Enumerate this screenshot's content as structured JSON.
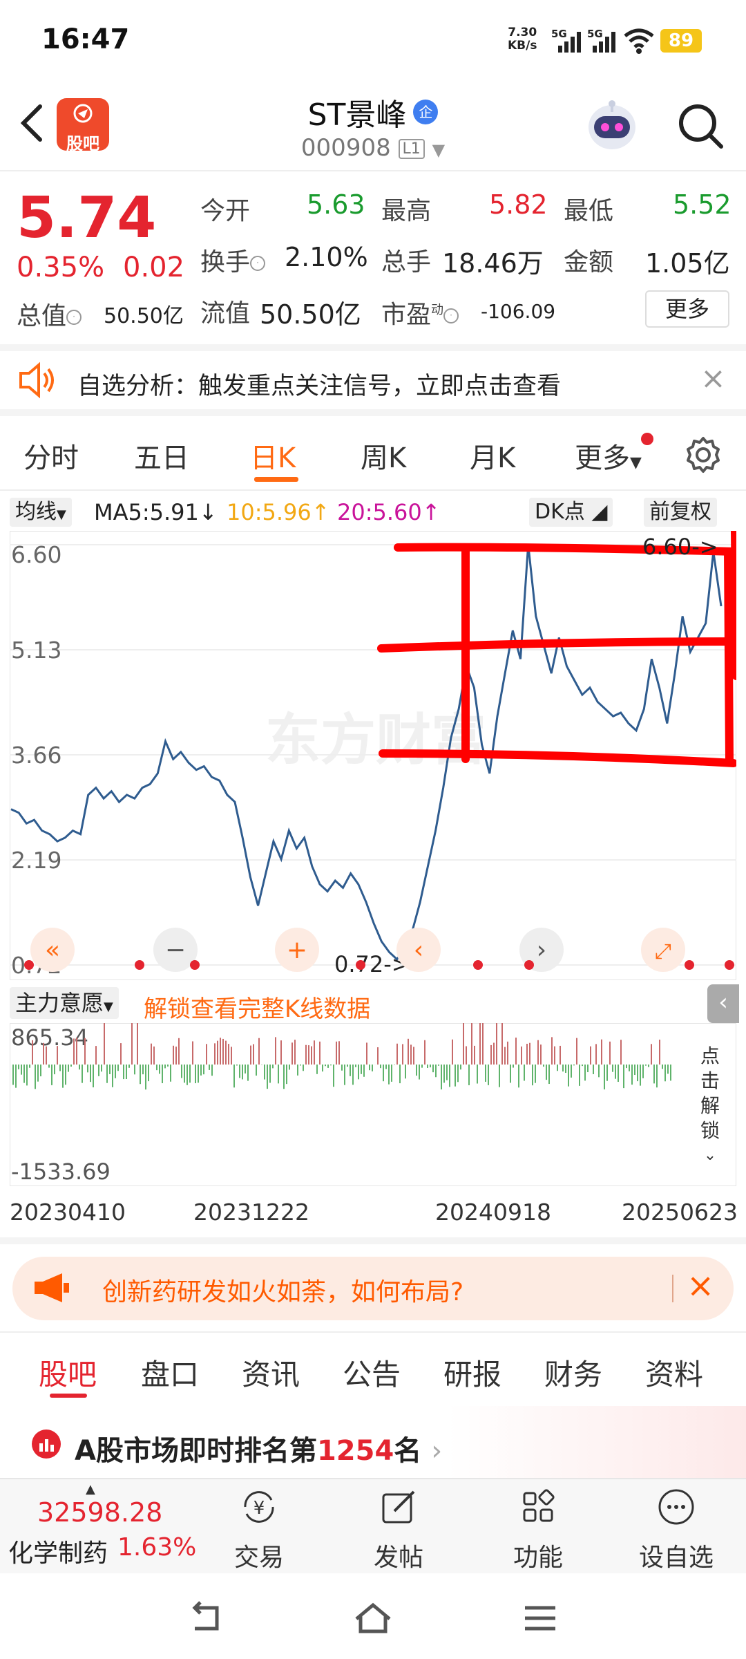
{
  "status_bar": {
    "time": "16:47",
    "net_speed_value": "7.30",
    "net_speed_unit": "KB/s",
    "signal_1": "5G",
    "signal_2": "5G",
    "battery": "89"
  },
  "header": {
    "logo_text": "股吧",
    "stock_name": "ST景峰",
    "qi_badge": "企",
    "stock_code": "000908",
    "level_badge": "L1"
  },
  "quote": {
    "price": "5.74",
    "change_pct": "0.35%",
    "change_abs": "0.02",
    "open_label": "今开",
    "open": "5.63",
    "high_label": "最高",
    "high": "5.82",
    "low_label": "最低",
    "low": "5.52",
    "turnover_label": "换手",
    "turnover": "2.10%",
    "volume_label": "总手",
    "volume": "18.46万",
    "amount_label": "金额",
    "amount": "1.05亿",
    "total_cap_label": "总值",
    "total_cap": "50.50亿",
    "float_cap_label": "流值",
    "float_cap": "50.50亿",
    "pe_label": "市盈",
    "pe_sup": "动",
    "pe": "-106.09",
    "more_label": "更多"
  },
  "banner": {
    "text": "自选分析：触发重点关注信号，立即点击查看"
  },
  "chart_tabs": [
    "分时",
    "五日",
    "日K",
    "周K",
    "月K",
    "更多"
  ],
  "ma_row": {
    "selector": "均线",
    "ma5": "MA5:5.91↓",
    "ma10": "10:5.96↑",
    "ma20": "20:5.60↑",
    "dk": "DK点",
    "fuquan": "前复权"
  },
  "main_chart": {
    "axis_labels": [
      "6.60",
      "5.13",
      "3.66",
      "2.19",
      "0.72"
    ],
    "max_marker": "6.60->",
    "min_marker": "0.72->",
    "watermark": "东方财富"
  },
  "volume_chart": {
    "selector": "主力意愿",
    "unlock_text": "解锁查看完整K线数据",
    "max_label": "865.34",
    "min_label": "-1533.69",
    "side_unlock": [
      "点",
      "击",
      "解",
      "锁"
    ]
  },
  "date_labels": [
    "20230410",
    "20231222",
    "20240918",
    "20250623"
  ],
  "promo": {
    "text": "创新药研发如火如荼，如何布局?"
  },
  "bottom_tabs": [
    "股吧",
    "盘口",
    "资讯",
    "公告",
    "研报",
    "财务",
    "资料"
  ],
  "rank": {
    "prefix": "A股市场即时排名第",
    "number": "1254",
    "suffix": "名"
  },
  "footer": {
    "sector_value": "32598.28",
    "sector_name": "化学制药",
    "sector_pct": "1.63%",
    "buttons": [
      "交易",
      "发帖",
      "功能",
      "设自选"
    ]
  },
  "colors": {
    "up": "#e4242f",
    "down": "#1a9b2e",
    "accent": "#ff6a13",
    "line": "#2f5c8f"
  },
  "chart_data": {
    "type": "line",
    "ylim": [
      0.72,
      6.6
    ],
    "x_labels": [
      "20230410",
      "20231222",
      "20240918",
      "20250623"
    ],
    "price_series": [
      2.9,
      2.85,
      2.7,
      2.75,
      2.6,
      2.55,
      2.45,
      2.5,
      2.6,
      2.55,
      3.1,
      3.2,
      3.05,
      3.15,
      3.0,
      3.1,
      3.05,
      3.2,
      3.25,
      3.4,
      3.85,
      3.6,
      3.7,
      3.55,
      3.45,
      3.5,
      3.35,
      3.3,
      3.1,
      3.0,
      2.5,
      1.95,
      1.55,
      2.0,
      2.45,
      2.2,
      2.6,
      2.35,
      2.5,
      2.1,
      1.85,
      1.75,
      1.9,
      1.8,
      2.0,
      1.85,
      1.6,
      1.3,
      1.05,
      0.9,
      0.8,
      0.95,
      1.2,
      1.6,
      2.1,
      2.6,
      3.2,
      3.9,
      4.3,
      4.9,
      4.6,
      3.8,
      3.4,
      4.2,
      4.8,
      5.4,
      5.0,
      6.6,
      5.6,
      5.2,
      4.8,
      5.3,
      4.9,
      4.7,
      4.5,
      4.6,
      4.4,
      4.3,
      4.2,
      4.25,
      4.1,
      4.0,
      4.3,
      5.0,
      4.6,
      4.1,
      4.8,
      5.6,
      5.1,
      5.3,
      5.5,
      6.5,
      5.74
    ]
  }
}
